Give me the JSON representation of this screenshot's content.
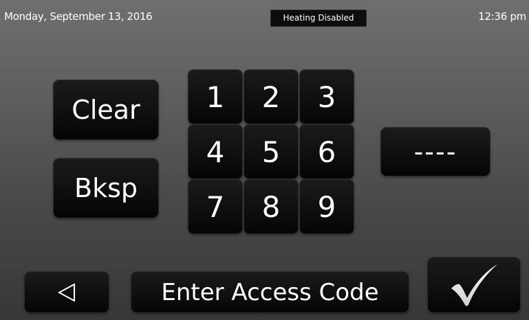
{
  "status_bar": {
    "date": "Monday, September 13, 2016",
    "badge": "Heating Disabled",
    "time": "12:36 pm"
  },
  "keypad": {
    "keys": [
      "1",
      "2",
      "3",
      "4",
      "5",
      "6",
      "7",
      "8",
      "9"
    ]
  },
  "actions": {
    "clear_label": "Clear",
    "backspace_label": "Bksp"
  },
  "code_display": {
    "value": "----"
  },
  "footer": {
    "back_icon": "triangle-left-icon",
    "prompt": "Enter Access Code",
    "confirm_icon": "checkmark-icon"
  }
}
